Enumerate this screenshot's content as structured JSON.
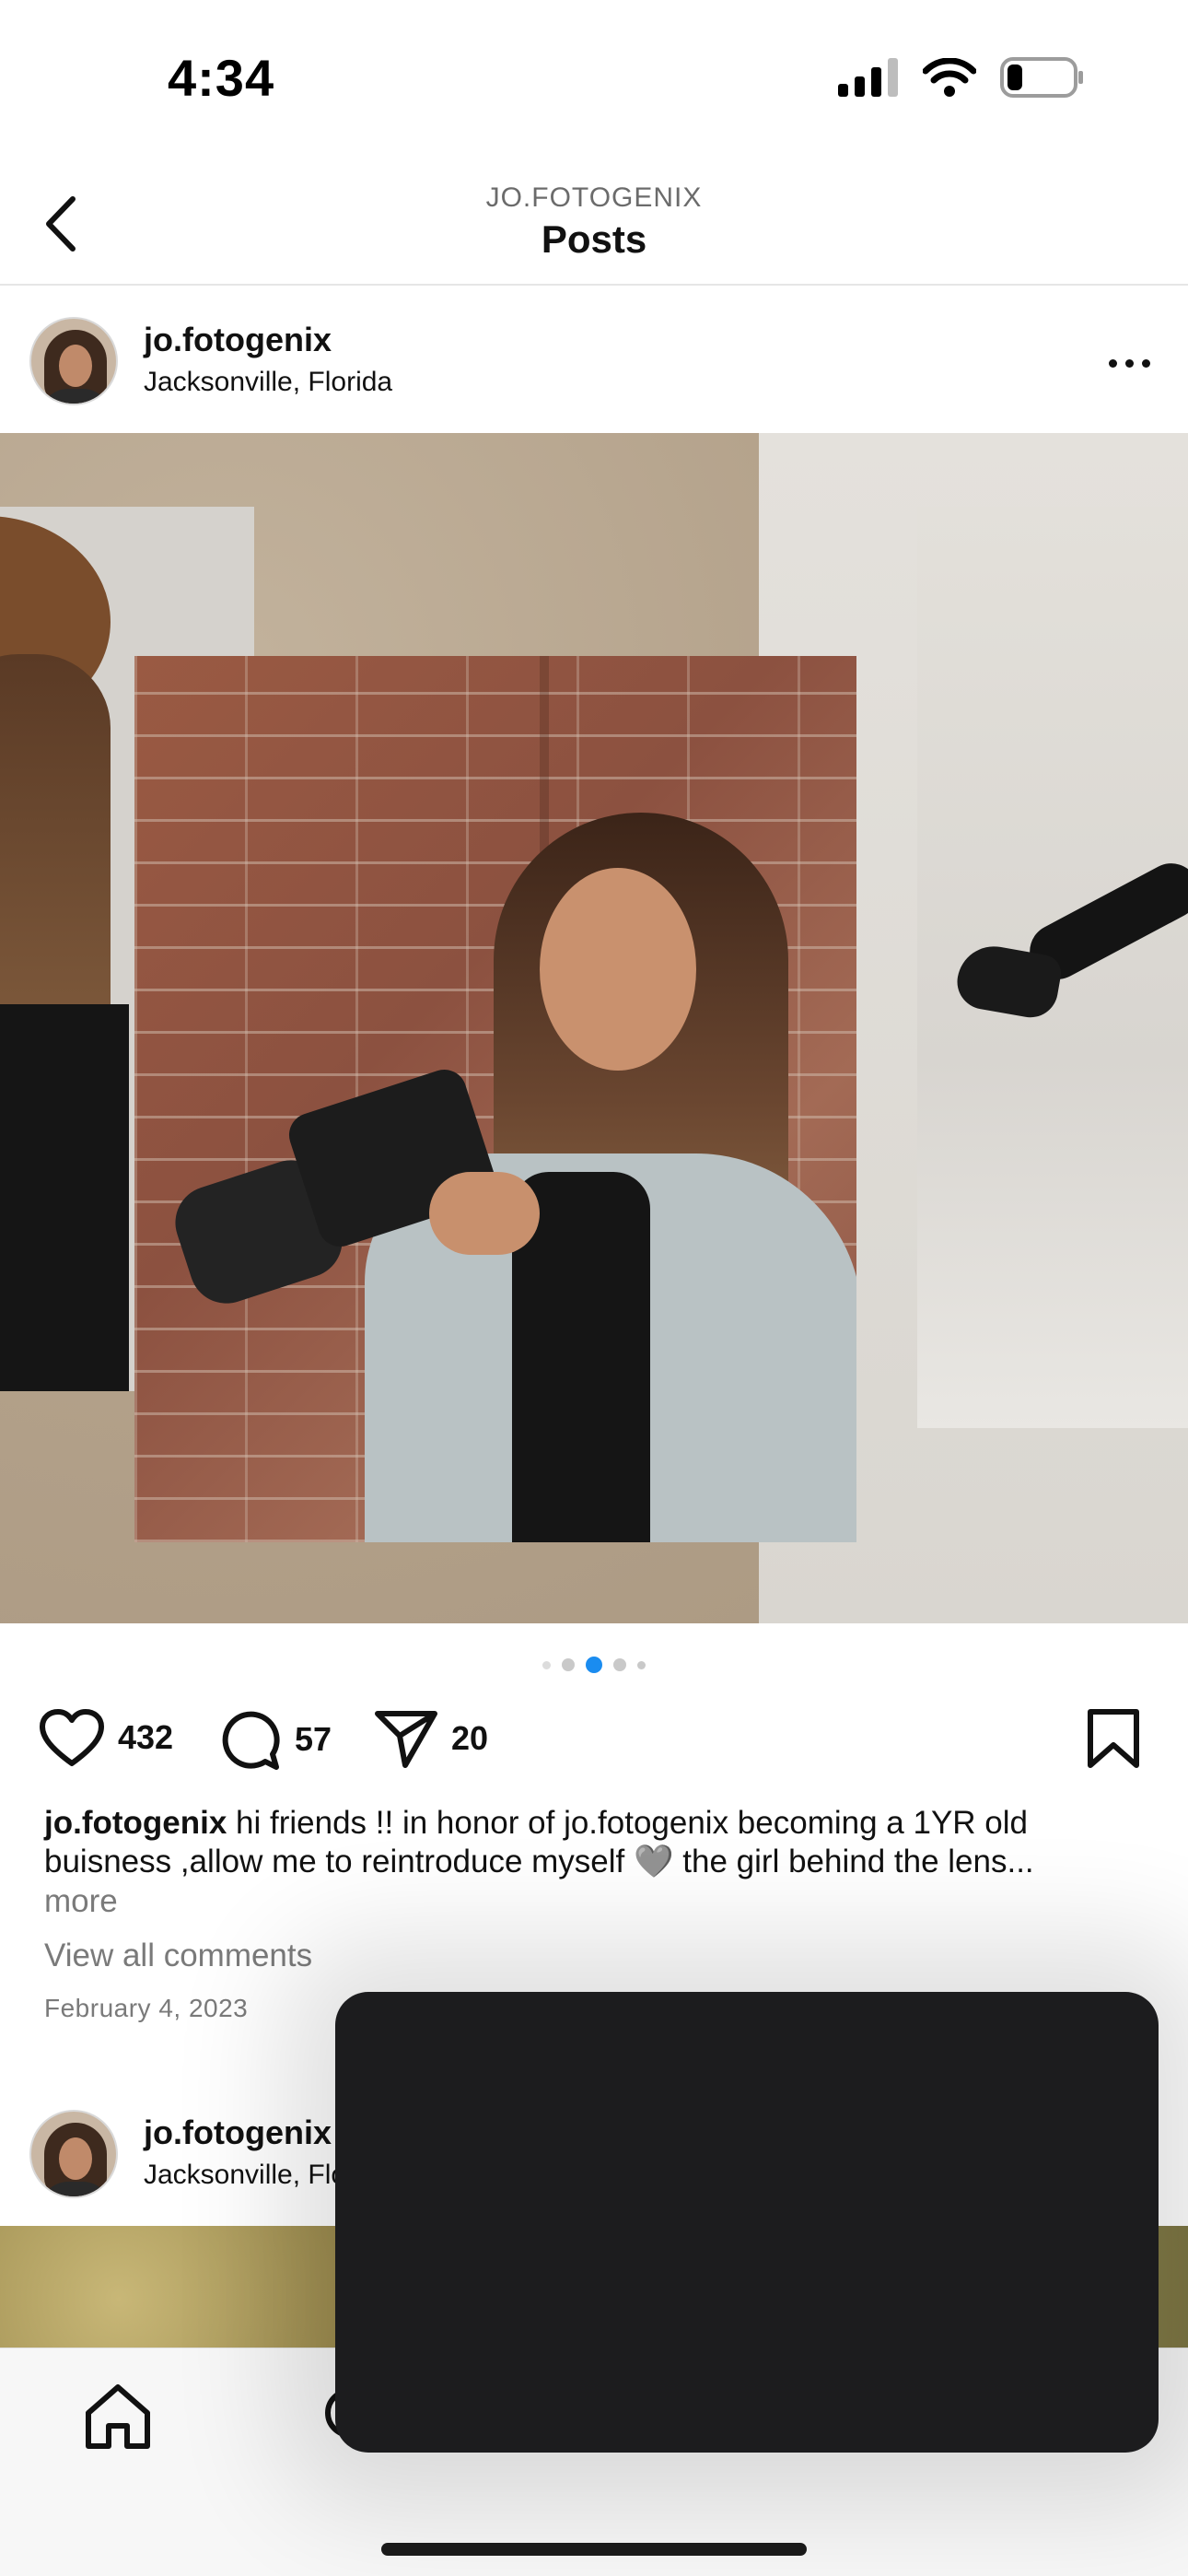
{
  "status_bar": {
    "time": "4:34"
  },
  "header": {
    "account_label": "JO.FOTOGENIX",
    "title": "Posts"
  },
  "posts": [
    {
      "username": "jo.fotogenix",
      "location": "Jacksonville, Florida",
      "carousel": {
        "total": 5,
        "active": 2
      },
      "likes": "432",
      "comments": "57",
      "shares": "20",
      "caption_user": "jo.fotogenix",
      "caption_text": " hi friends !! in honor of jo.fotogenix becoming a 1YR old buisness ,allow me to reintroduce myself 🩶 the girl behind the lens...",
      "more_label": "more",
      "view_comments": "View all comments",
      "date": "February 4, 2023"
    },
    {
      "username": "jo.fotogenix",
      "location": "Jacksonville, Florida"
    }
  ],
  "icons": {
    "back": "chevron-left-icon",
    "more": "more-horizontal-icon",
    "like": "heart-icon",
    "comment": "comment-bubble-icon",
    "share": "paper-plane-icon",
    "save": "bookmark-icon",
    "home": "home-icon",
    "search": "search-icon"
  },
  "colors": {
    "carousel_active": "#1a8cf0",
    "overlay": "#1c1c1e"
  }
}
